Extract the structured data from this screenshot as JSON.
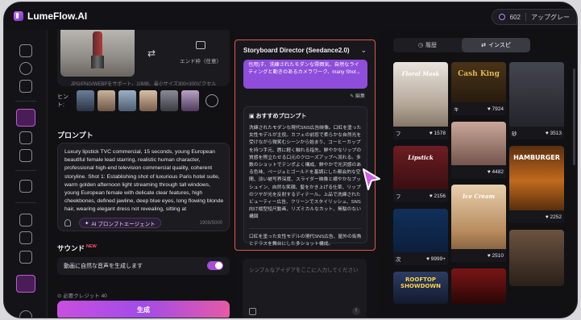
{
  "app": {
    "brand": "LumeFlow.AI"
  },
  "header": {
    "credits": "602",
    "upgrade_label": "アップグレー"
  },
  "upload": {
    "end_frame_label": "エンド枠（任意）",
    "note": "JPG/PNG/WEBPをサポート、10MB、最小サイズ300×300ピクセル",
    "hint_label": "ヒント:"
  },
  "prompt": {
    "section_title": "プロンプト",
    "text": "Luxury lipstick TVC commercial, 15 seconds, young European beautiful female lead starring, realistic human character, professional high-end television commercial quality, coherent storyline. Shot 1: Establishing shot of luxurious Paris hotel suite, warm golden afternoon light streaming through tall windows, young European female with delicate clear features, high cheekbones, defined jawline, deep blue eyes, long flowing blonde hair, wearing elegant dress not revealing, sitting at",
    "agent_button": "AI プロンプトエージェント",
    "counter": "1908/5000"
  },
  "sound": {
    "label": "サウンド",
    "badge": "NEW",
    "toggle_label": "動画に自然な音声を生成します",
    "toggle_on": true
  },
  "generate": {
    "credit_note": "必要クレジット 40",
    "button": "生成"
  },
  "director": {
    "title": "Storyboard Director (Seedance2.0)",
    "bubble": "也用)す、洗練されたモダンな雰囲気、自然なライティングと動きのあるカメラワーク、many Shot 。",
    "edit_label": "編集",
    "reco_title": "おすすめプロンプト",
    "reco_text": "洗練されたモダンな現代SNS広告映像。口紅を塗った女性モデルが主役。カフェの前窓で柔らかな自然光を受けながら微笑むシーンから始まり、コーヒーカップを持つ手元、唇に軽く触れる指先、鮮やかなリップの質感を際立たせる口元のクローズアップへ流れる。多数のショットでテンポよく構成、鮮やかで光沢感のある色味、ベージュとゴールドを基調にした都会的な空間、淡い被写界深度、スライダー映像と横やかなプッシュイン、自然な笑顔、髪をかき上げる仕草、リップのツヤが光を反射するディテール。上品で洗練されたビューティー広告、クリーンでスタイリッシュ、SNS向け縦型短尺動画、リズミカルなカット、無駄のない構図",
    "reco_text2": "口紅を塗った女性モデルの現代SNS広告、屋外の街角とテラスを舞台にした多ショット構成。",
    "idea_placeholder": "シンプルなアイデアをここに入力してください"
  },
  "gallery": {
    "tabs": [
      {
        "label": "履歴",
        "active": false
      },
      {
        "label": "インスピ",
        "active": true
      }
    ],
    "cards": [
      {
        "title": "フ",
        "likes": "1578",
        "art_text": "Floral Mask"
      },
      {
        "title": "キ",
        "likes": "7924",
        "art_text": "Cash King"
      },
      {
        "title": "砂",
        "likes": "3513",
        "art_text": ""
      },
      {
        "title": "フ",
        "likes": "2156",
        "art_text": "Lipstick"
      },
      {
        "title": "",
        "likes": "4482",
        "art_text": ""
      },
      {
        "title": "",
        "likes": "2252",
        "art_text": "HAMBURGER"
      },
      {
        "title": "次",
        "likes": "9999+",
        "art_text": ""
      },
      {
        "title": "",
        "likes": "2510",
        "art_text": "Ice Cream"
      },
      {
        "title": "",
        "likes": "",
        "art_text": ""
      },
      {
        "title": "",
        "likes": "",
        "art_text": "ROOFTOP SHOWDOWN"
      },
      {
        "title": "",
        "likes": "",
        "art_text": ""
      }
    ]
  },
  "colors": {
    "accent": "#a64fd6",
    "highlight_border": "#e2574c",
    "bubble": "#8e4ddb"
  }
}
